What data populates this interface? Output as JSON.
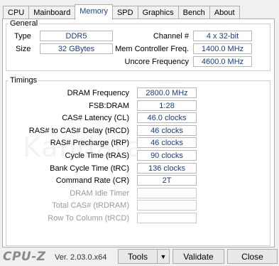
{
  "tabs": [
    "CPU",
    "Mainboard",
    "Memory",
    "SPD",
    "Graphics",
    "Bench",
    "About"
  ],
  "general": {
    "title": "General",
    "type_label": "Type",
    "type_value": "DDR5",
    "size_label": "Size",
    "size_value": "32 GBytes",
    "channel_label": "Channel #",
    "channel_value": "4 x 32-bit",
    "mcf_label": "Mem Controller Freq.",
    "mcf_value": "1400.0 MHz",
    "uncore_label": "Uncore Frequency",
    "uncore_value": "4600.0 MHz"
  },
  "timings": {
    "title": "Timings",
    "rows": [
      {
        "label": "DRAM Frequency",
        "value": "2800.0 MHz"
      },
      {
        "label": "FSB:DRAM",
        "value": "1:28"
      },
      {
        "label": "CAS# Latency (CL)",
        "value": "46.0 clocks"
      },
      {
        "label": "RAS# to CAS# Delay (tRCD)",
        "value": "46 clocks"
      },
      {
        "label": "RAS# Precharge (tRP)",
        "value": "46 clocks"
      },
      {
        "label": "Cycle Time (tRAS)",
        "value": "90 clocks"
      },
      {
        "label": "Bank Cycle Time (tRC)",
        "value": "136 clocks"
      },
      {
        "label": "Command Rate (CR)",
        "value": "2T"
      },
      {
        "label": "DRAM Idle Timer",
        "value": ""
      },
      {
        "label": "Total CAS# (tRDRAM)",
        "value": ""
      },
      {
        "label": "Row To Column (tRCD)",
        "value": ""
      }
    ]
  },
  "footer": {
    "brand": "CPU-Z",
    "version": "Ver. 2.03.0.x64",
    "tools_label": "Tools",
    "validate_label": "Validate",
    "close_label": "Close"
  },
  "watermark": "Kandara"
}
